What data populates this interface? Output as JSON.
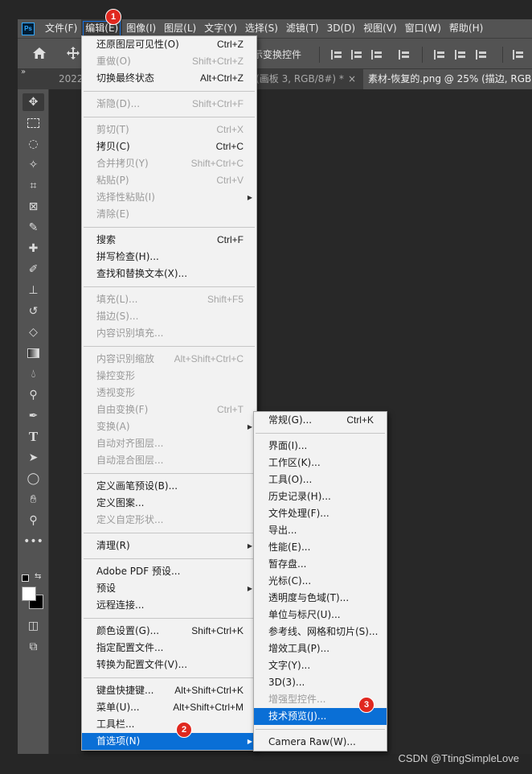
{
  "menubar": {
    "logo": "Ps",
    "items": [
      "文件(F)",
      "编辑(E)",
      "图像(I)",
      "图层(L)",
      "文字(Y)",
      "选择(S)",
      "滤镜(T)",
      "3D(D)",
      "视图(V)",
      "窗口(W)",
      "帮助(H)"
    ]
  },
  "optbar": {
    "transform_label": "示变换控件"
  },
  "tabs": [
    {
      "label": "2022"
    },
    {
      "label": "s (画板 3, RGB/8#) *",
      "close": "×"
    },
    {
      "label": "素材-恢复的.png @ 25% (描边, RGB"
    }
  ],
  "edit_menu": {
    "groups": [
      [
        {
          "label": "还原图层可见性(O)",
          "shortcut": "Ctrl+Z",
          "disabled": false
        },
        {
          "label": "重做(O)",
          "shortcut": "Shift+Ctrl+Z",
          "disabled": true
        },
        {
          "label": "切换最终状态",
          "shortcut": "Alt+Ctrl+Z",
          "disabled": false
        }
      ],
      [
        {
          "label": "渐隐(D)...",
          "shortcut": "Shift+Ctrl+F",
          "disabled": true
        }
      ],
      [
        {
          "label": "剪切(T)",
          "shortcut": "Ctrl+X",
          "disabled": true
        },
        {
          "label": "拷贝(C)",
          "shortcut": "Ctrl+C",
          "disabled": false
        },
        {
          "label": "合并拷贝(Y)",
          "shortcut": "Shift+Ctrl+C",
          "disabled": true
        },
        {
          "label": "粘贴(P)",
          "shortcut": "Ctrl+V",
          "disabled": true
        },
        {
          "label": "选择性粘贴(I)",
          "shortcut": "",
          "disabled": true,
          "submenu": true
        },
        {
          "label": "清除(E)",
          "shortcut": "",
          "disabled": true
        }
      ],
      [
        {
          "label": "搜索",
          "shortcut": "Ctrl+F",
          "disabled": false
        },
        {
          "label": "拼写检查(H)...",
          "shortcut": "",
          "disabled": false
        },
        {
          "label": "查找和替换文本(X)...",
          "shortcut": "",
          "disabled": false
        }
      ],
      [
        {
          "label": "填充(L)...",
          "shortcut": "Shift+F5",
          "disabled": true
        },
        {
          "label": "描边(S)...",
          "shortcut": "",
          "disabled": true
        },
        {
          "label": "内容识别填充...",
          "shortcut": "",
          "disabled": true
        }
      ],
      [
        {
          "label": "内容识别缩放",
          "shortcut": "Alt+Shift+Ctrl+C",
          "disabled": true
        },
        {
          "label": "操控变形",
          "shortcut": "",
          "disabled": true
        },
        {
          "label": "透视变形",
          "shortcut": "",
          "disabled": true
        },
        {
          "label": "自由变换(F)",
          "shortcut": "Ctrl+T",
          "disabled": true
        },
        {
          "label": "变换(A)",
          "shortcut": "",
          "disabled": true,
          "submenu": true
        },
        {
          "label": "自动对齐图层...",
          "shortcut": "",
          "disabled": true
        },
        {
          "label": "自动混合图层...",
          "shortcut": "",
          "disabled": true
        }
      ],
      [
        {
          "label": "定义画笔预设(B)...",
          "shortcut": "",
          "disabled": false
        },
        {
          "label": "定义图案...",
          "shortcut": "",
          "disabled": false
        },
        {
          "label": "定义自定形状...",
          "shortcut": "",
          "disabled": true
        }
      ],
      [
        {
          "label": "清理(R)",
          "shortcut": "",
          "disabled": false,
          "submenu": true
        }
      ],
      [
        {
          "label": "Adobe PDF 预设...",
          "shortcut": "",
          "disabled": false
        },
        {
          "label": "预设",
          "shortcut": "",
          "disabled": false,
          "submenu": true
        },
        {
          "label": "远程连接...",
          "shortcut": "",
          "disabled": false
        }
      ],
      [
        {
          "label": "颜色设置(G)...",
          "shortcut": "Shift+Ctrl+K",
          "disabled": false
        },
        {
          "label": "指定配置文件...",
          "shortcut": "",
          "disabled": false
        },
        {
          "label": "转换为配置文件(V)...",
          "shortcut": "",
          "disabled": false
        }
      ],
      [
        {
          "label": "键盘快捷键...",
          "shortcut": "Alt+Shift+Ctrl+K",
          "disabled": false
        },
        {
          "label": "菜单(U)...",
          "shortcut": "Alt+Shift+Ctrl+M",
          "disabled": false
        },
        {
          "label": "工具栏...",
          "shortcut": "",
          "disabled": false
        },
        {
          "label": "首选项(N)",
          "shortcut": "",
          "disabled": false,
          "submenu": true,
          "highlighted": true
        }
      ]
    ]
  },
  "prefs_menu": {
    "groups": [
      [
        {
          "label": "常规(G)...",
          "shortcut": "Ctrl+K",
          "disabled": false
        }
      ],
      [
        {
          "label": "界面(I)...",
          "shortcut": "",
          "disabled": false
        },
        {
          "label": "工作区(K)...",
          "shortcut": "",
          "disabled": false
        },
        {
          "label": "工具(O)...",
          "shortcut": "",
          "disabled": false
        },
        {
          "label": "历史记录(H)...",
          "shortcut": "",
          "disabled": false
        },
        {
          "label": "文件处理(F)...",
          "shortcut": "",
          "disabled": false
        },
        {
          "label": "导出...",
          "shortcut": "",
          "disabled": false
        },
        {
          "label": "性能(E)...",
          "shortcut": "",
          "disabled": false
        },
        {
          "label": "暂存盘...",
          "shortcut": "",
          "disabled": false
        },
        {
          "label": "光标(C)...",
          "shortcut": "",
          "disabled": false
        },
        {
          "label": "透明度与色域(T)...",
          "shortcut": "",
          "disabled": false
        },
        {
          "label": "单位与标尺(U)...",
          "shortcut": "",
          "disabled": false
        },
        {
          "label": "参考线、网格和切片(S)...",
          "shortcut": "",
          "disabled": false
        },
        {
          "label": "增效工具(P)...",
          "shortcut": "",
          "disabled": false
        },
        {
          "label": "文字(Y)...",
          "shortcut": "",
          "disabled": false
        },
        {
          "label": "3D(3)...",
          "shortcut": "",
          "disabled": false
        },
        {
          "label": "增强型控件...",
          "shortcut": "",
          "disabled": true
        },
        {
          "label": "技术预览(J)...",
          "shortcut": "",
          "disabled": false,
          "highlighted": true
        }
      ],
      [
        {
          "label": "Camera Raw(W)...",
          "shortcut": "",
          "disabled": false
        }
      ]
    ]
  },
  "badges": [
    "1",
    "2",
    "3"
  ],
  "watermark": "CSDN @TtingSimpleLove",
  "colors": {
    "highlight": "#0a6fd6",
    "badge": "#e0281f",
    "menubar": "#535353"
  }
}
